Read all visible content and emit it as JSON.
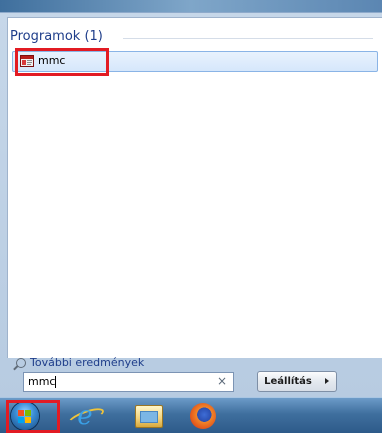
{
  "start_menu": {
    "section_title": "Programok (1)",
    "results": [
      {
        "label": "mmc",
        "icon": "mmc-console-icon"
      }
    ],
    "more_results_label": "További eredmények",
    "search": {
      "value": "mmc",
      "clear_symbol": "×"
    },
    "shutdown_label": "Leállítás"
  },
  "taskbar": {
    "items": [
      {
        "name": "start-button",
        "icon": "windows-logo-icon"
      },
      {
        "name": "internet-explorer",
        "icon": "internet-explorer-icon",
        "glyph": "e"
      },
      {
        "name": "windows-explorer",
        "icon": "folder-icon"
      },
      {
        "name": "firefox",
        "icon": "firefox-icon"
      }
    ]
  },
  "colors": {
    "highlight": "#e21b23",
    "link_text": "#1e3d8a",
    "taskbar": "#3f6f9e"
  }
}
